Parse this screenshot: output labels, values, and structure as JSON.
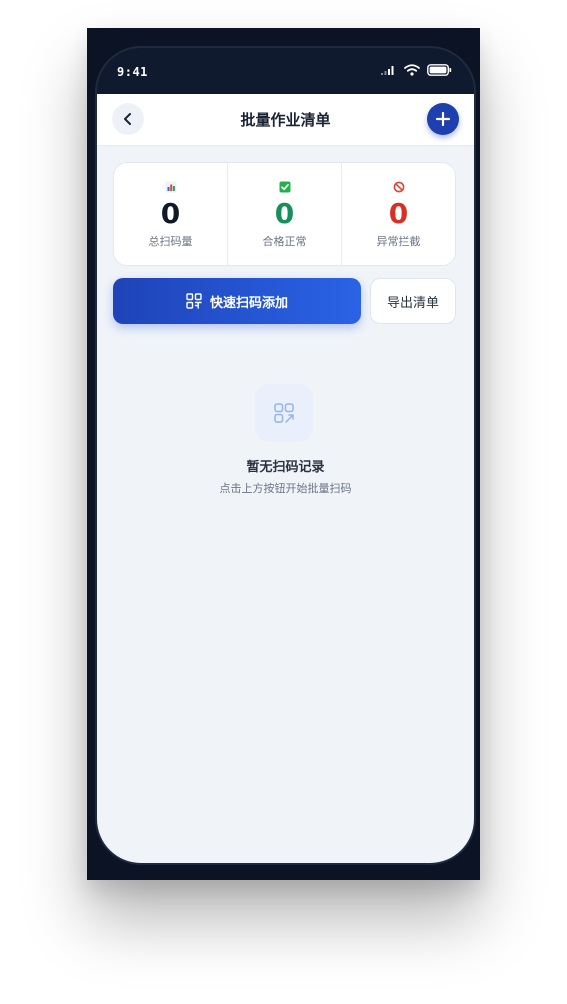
{
  "status_bar": {
    "time": "9:41"
  },
  "nav": {
    "title": "批量作业清单"
  },
  "stats": [
    {
      "icon": "bar-chart-icon",
      "value": "0",
      "label": "总扫码量",
      "color": "#111827"
    },
    {
      "icon": "check-mark-icon",
      "value": "0",
      "label": "合格正常",
      "color": "#16905a"
    },
    {
      "icon": "prohibited-icon",
      "value": "0",
      "label": "异常拦截",
      "color": "#d93025"
    }
  ],
  "actions": {
    "scan_label": "快速扫码添加",
    "export_label": "导出清单"
  },
  "empty_state": {
    "title": "暂无扫码记录",
    "subtitle": "点击上方按钮开始批量扫码"
  },
  "colors": {
    "primary": "#1e3fae",
    "success": "#16905a",
    "danger": "#d93025",
    "background": "#f0f4f9"
  }
}
